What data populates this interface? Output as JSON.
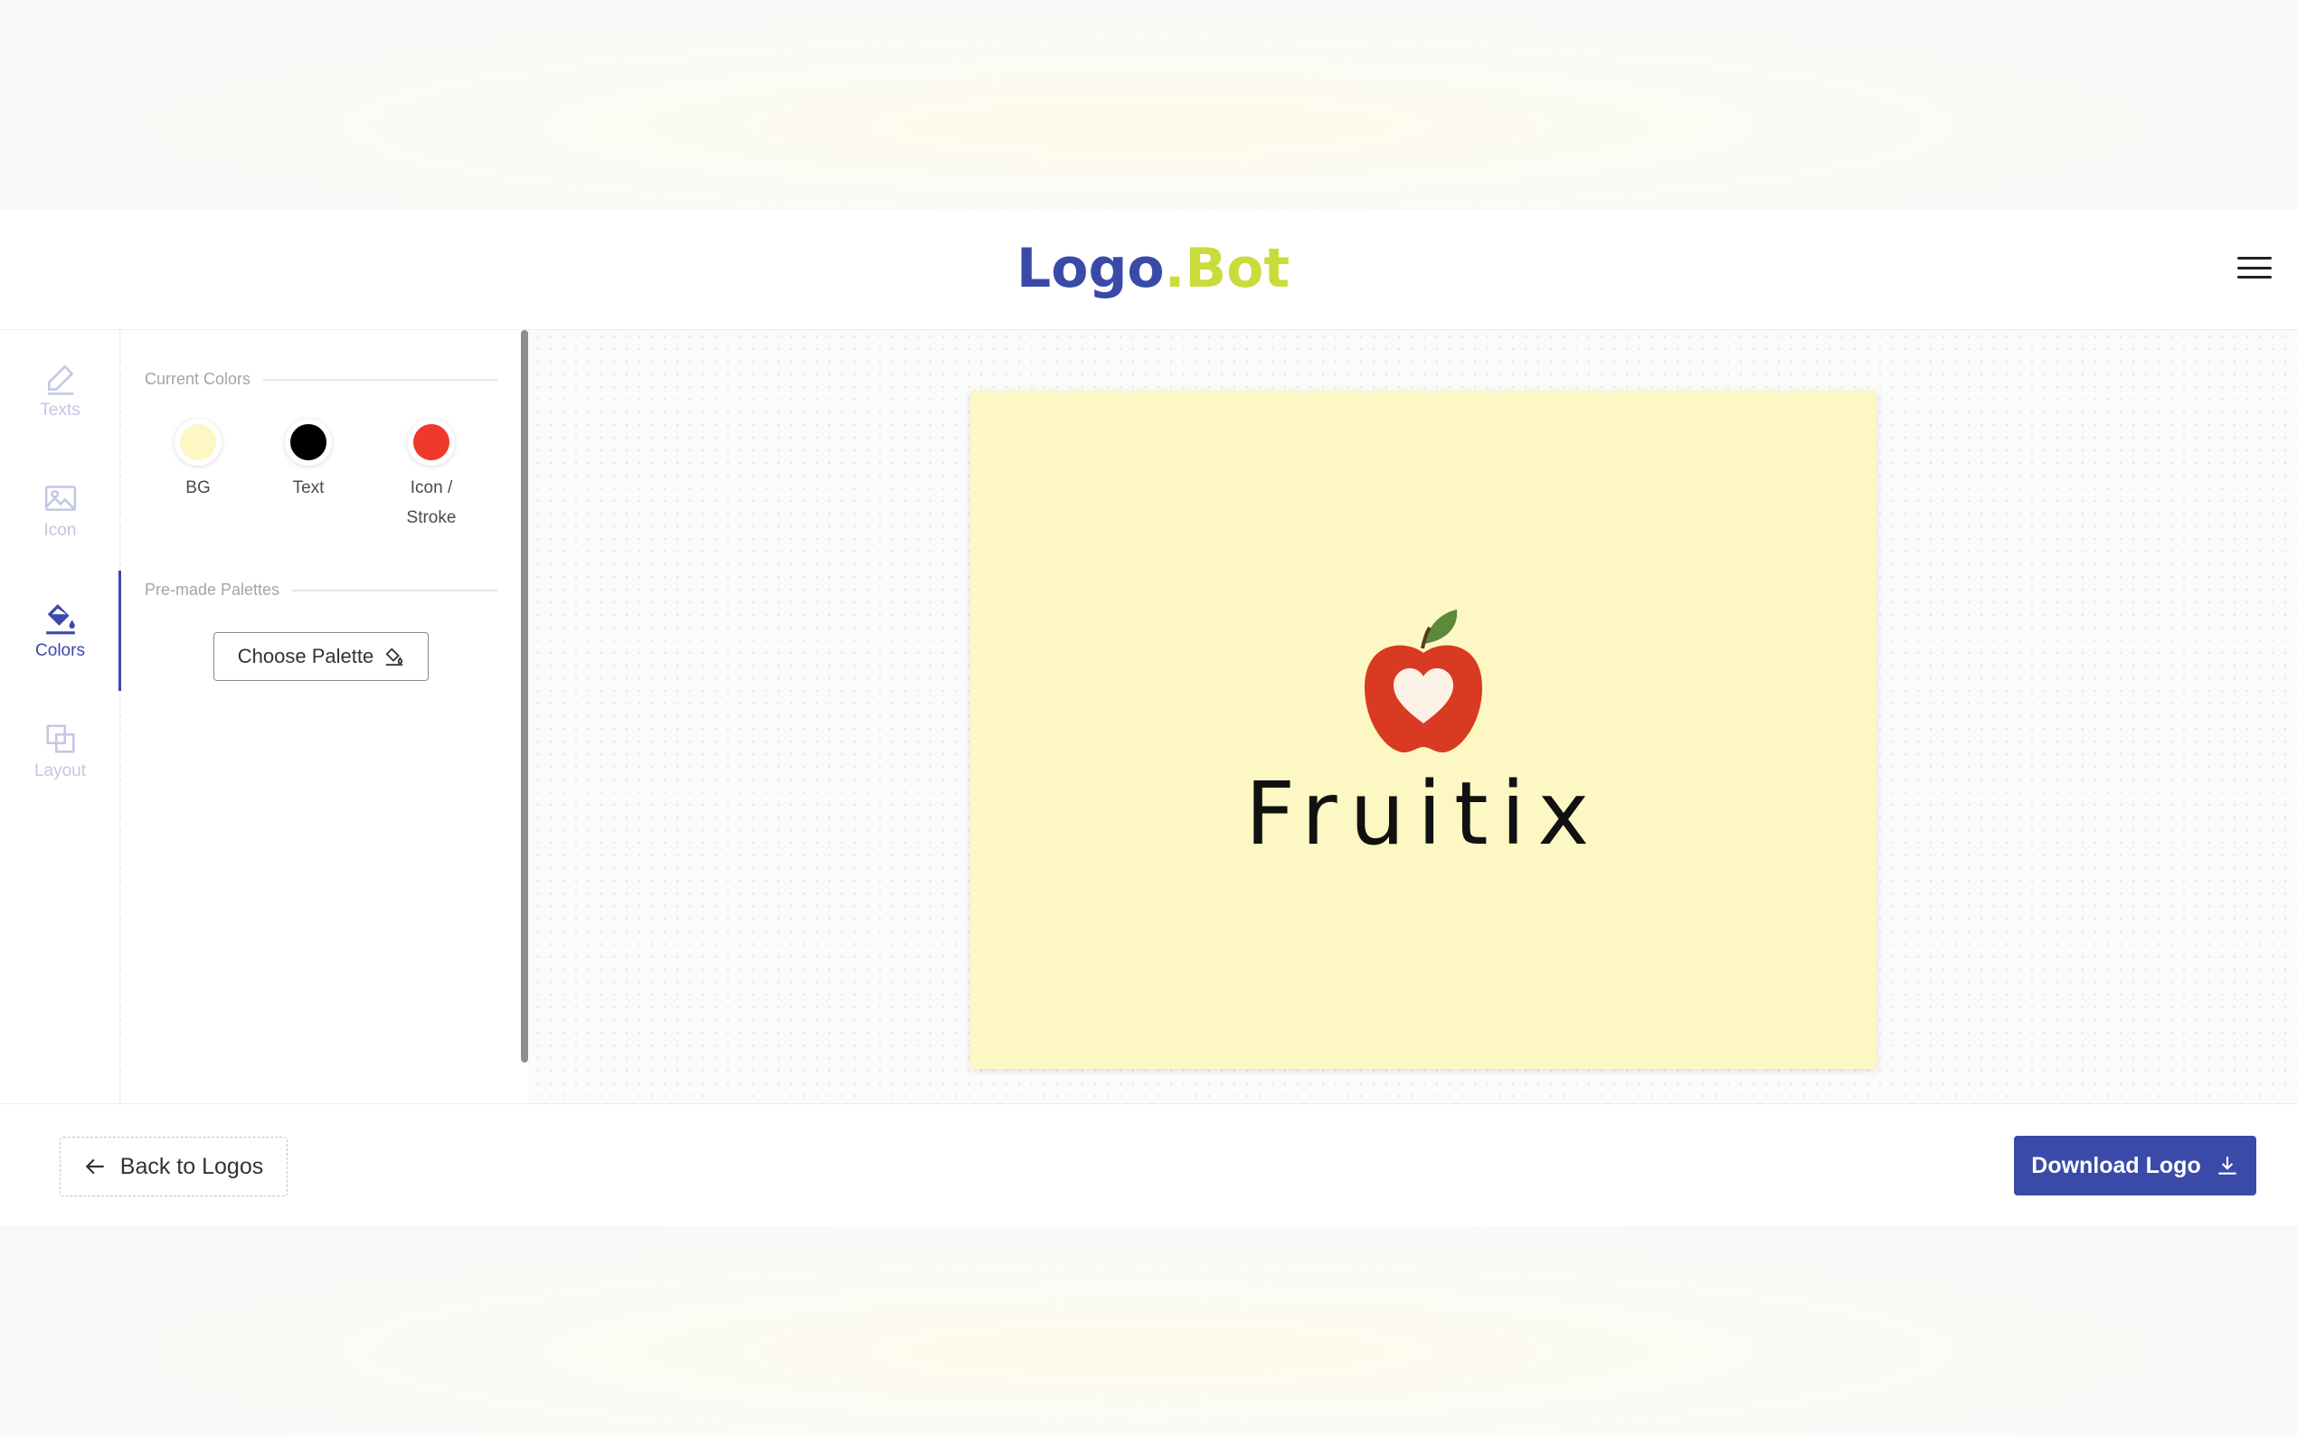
{
  "brand": {
    "part1": "Logo",
    "dot": ".",
    "part2": "Bot",
    "color_primary": "#3a4aa9",
    "color_accent": "#c9dc3a"
  },
  "header": {
    "menu_icon": "hamburger-menu-icon"
  },
  "sidebar": {
    "items": [
      {
        "label": "Texts",
        "icon": "pencil-icon",
        "active": false
      },
      {
        "label": "Icon",
        "icon": "image-icon",
        "active": false
      },
      {
        "label": "Colors",
        "icon": "paint-bucket-icon",
        "active": true
      },
      {
        "label": "Layout",
        "icon": "layout-icon",
        "active": false
      }
    ]
  },
  "colors_panel": {
    "current_title": "Current Colors",
    "swatches": [
      {
        "label": "BG",
        "color": "#fdf7c3"
      },
      {
        "label": "Text",
        "color": "#000000"
      },
      {
        "label_line1": "Icon /",
        "label_line2": "Stroke",
        "color": "#f0392b"
      }
    ],
    "premade_title": "Pre-made Palettes",
    "choose_palette": "Choose Palette"
  },
  "canvas": {
    "background": "#fdf7c3",
    "logo_name": "Fruitix",
    "icon": "apple-heart-icon"
  },
  "footer": {
    "back_label": "Back to Logos",
    "download_label": "Download Logo"
  }
}
